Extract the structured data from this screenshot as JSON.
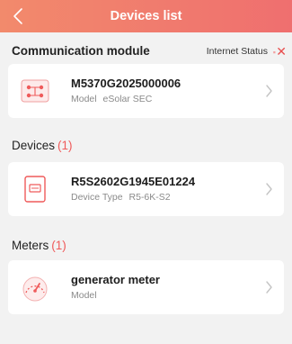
{
  "header": {
    "back_icon": "chevron-left-icon",
    "title": "Devices list"
  },
  "communication": {
    "heading": "Communication module",
    "internet_status_label": "Internet Status",
    "internet_status_icon": "close-icon",
    "module": {
      "serial": "M5370G2025000006",
      "model_label": "Model",
      "model_value": "eSolar SEC",
      "icon": "communication-module-icon"
    }
  },
  "devices": {
    "heading": "Devices",
    "count": "(1)",
    "items": [
      {
        "serial": "R5S2602G1945E01224",
        "type_label": "Device Type",
        "type_value": "R5-6K-S2",
        "icon": "inverter-icon"
      }
    ]
  },
  "meters": {
    "heading": "Meters",
    "count": "(1)",
    "items": [
      {
        "name": "generator meter",
        "model_label": "Model",
        "model_value": "",
        "icon": "meter-gauge-icon"
      }
    ]
  },
  "colors": {
    "header_gradient_start": "#f28a6c",
    "header_gradient_end": "#ef6f6f",
    "accent_red": "#ef5a5a",
    "background": "#f2f2f2"
  }
}
